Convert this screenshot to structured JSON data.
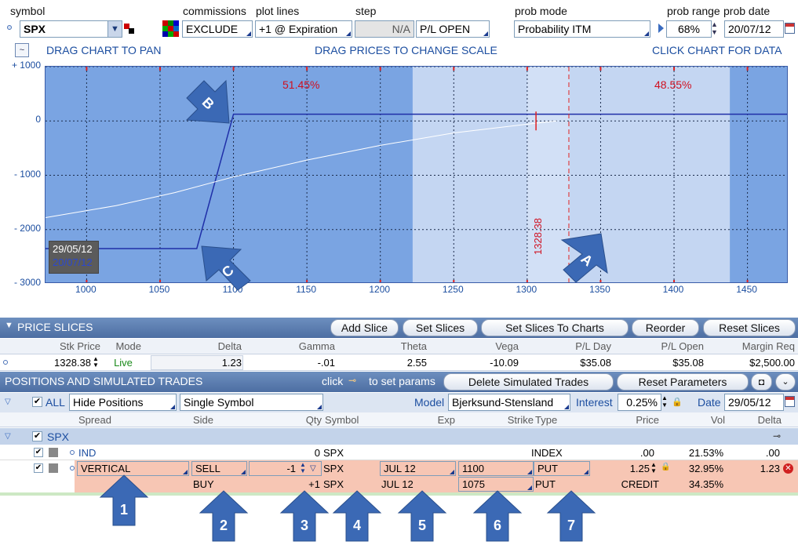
{
  "top": {
    "symbol_label": "symbol",
    "symbol_value": "SPX",
    "commissions_label": "commissions",
    "commissions_value": "EXCLUDE",
    "plot_lines_label": "plot lines",
    "plot_lines_value": "+1 @ Expiration",
    "step_label": "step",
    "step_value": "N/A",
    "step_mode": "P/L OPEN",
    "prob_mode_label": "prob mode",
    "prob_mode_value": "Probability ITM",
    "prob_range_label": "prob range",
    "prob_range_value": "68%",
    "prob_date_label": "prob date",
    "prob_date_value": "20/07/12"
  },
  "chart_bar": {
    "pan": "DRAG CHART TO PAN",
    "scale": "DRAG PRICES TO CHANGE SCALE",
    "click": "CLICK CHART FOR DATA"
  },
  "chart_data": {
    "type": "line",
    "y_ticks": [
      "+ 1000",
      "0",
      "- 1000",
      "- 2000",
      "- 3000"
    ],
    "x_ticks": [
      "1000",
      "1050",
      "1100",
      "1150",
      "1200",
      "1250",
      "1300",
      "1350",
      "1400",
      "1450"
    ],
    "xlim": [
      972,
      1478
    ],
    "ylim": [
      -3000,
      1000
    ],
    "prob_left": "51.45%",
    "prob_right": "48.55%",
    "price_marker": "1328.38",
    "date1": "29/05/12",
    "date2": "20/07/12",
    "series": [
      {
        "values_x": [
          972,
          1075,
          1100,
          1478
        ],
        "values_y": [
          -2350,
          -2350,
          125,
          125
        ],
        "color": "#1f2fa8"
      },
      {
        "values_x": [
          972,
          1020,
          1060,
          1100,
          1150,
          1200,
          1250,
          1300,
          1320
        ],
        "values_y": [
          -1780,
          -1560,
          -1320,
          -1030,
          -720,
          -450,
          -220,
          -60,
          0
        ],
        "color": "#ffffff"
      }
    ],
    "annotations": [
      "A",
      "B",
      "C"
    ]
  },
  "price_slices": {
    "title": "PRICE SLICES",
    "buttons": [
      "Add Slice",
      "Set Slices",
      "Set Slices To Charts",
      "Reorder",
      "Reset Slices"
    ],
    "headers": [
      "Stk Price",
      "Mode",
      "Delta",
      "Gamma",
      "Theta",
      "Vega",
      "P/L Day",
      "P/L Open",
      "Margin Req"
    ],
    "row": [
      "1328.38",
      "Live",
      "1.23",
      "-.01",
      "2.55",
      "-10.09",
      "$35.08",
      "$35.08",
      "$2,500.00"
    ]
  },
  "positions": {
    "title": "POSITIONS AND SIMULATED TRADES",
    "click_hint": "click",
    "set_params": "to set params",
    "delete_btn": "Delete Simulated Trades",
    "reset_btn": "Reset Parameters",
    "all_label": "ALL",
    "hide_positions": "Hide Positions",
    "single_symbol": "Single Symbol",
    "model_label": "Model",
    "model_value": "Bjerksund-Stensland",
    "interest_label": "Interest",
    "interest_value": "0.25%",
    "date_label": "Date",
    "date_value": "29/05/12",
    "headers": [
      "Spread",
      "Side",
      "Qty",
      "Symbol",
      "Exp",
      "Strike",
      "Type",
      "Price",
      "Vol",
      "Delta"
    ],
    "group": "SPX",
    "rows": [
      {
        "spread": "IND",
        "side": "",
        "qty": "0",
        "symbol": "SPX",
        "exp": "",
        "strike": "",
        "type": "INDEX",
        "price": ".00",
        "vol": "21.53%",
        "delta": ".00"
      },
      {
        "spread": "VERTICAL",
        "side": "SELL",
        "qty": "-1",
        "symbol": "SPX",
        "exp": "JUL 12",
        "strike": "1100",
        "type": "PUT",
        "price": "1.25",
        "vol": "32.95%",
        "delta": "1.23"
      },
      {
        "spread": "",
        "side": "BUY",
        "qty": "+1",
        "symbol": "SPX",
        "exp": "JUL 12",
        "strike": "1075",
        "type": "PUT",
        "price": "CREDIT",
        "vol": "34.35%",
        "delta": ""
      }
    ]
  },
  "callouts": [
    "1",
    "2",
    "3",
    "4",
    "5",
    "6",
    "7"
  ]
}
